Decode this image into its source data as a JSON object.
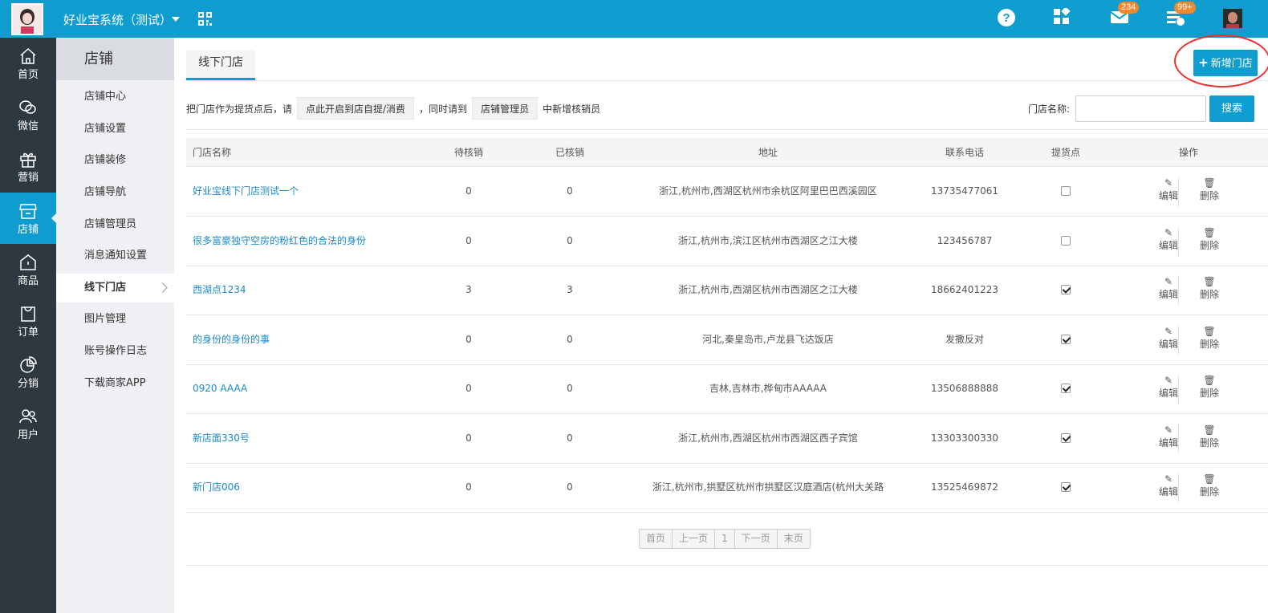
{
  "header": {
    "app_title": "好业宝系统（测试）",
    "messages_badge": "234",
    "tasks_badge": "99+",
    "icons": [
      "qrcode-icon",
      "help-icon",
      "apps-icon",
      "mail-icon",
      "tasks-icon"
    ]
  },
  "leftnav": {
    "items": [
      {
        "label": "首页",
        "icon": "home-icon"
      },
      {
        "label": "微信",
        "icon": "wechat-icon"
      },
      {
        "label": "营销",
        "icon": "gift-icon"
      },
      {
        "label": "店铺",
        "icon": "store-icon",
        "active": true
      },
      {
        "label": "商品",
        "icon": "bag-icon"
      },
      {
        "label": "订单",
        "icon": "order-icon"
      },
      {
        "label": "分销",
        "icon": "pie-icon"
      },
      {
        "label": "用户",
        "icon": "users-icon"
      }
    ]
  },
  "subnav": {
    "title": "店铺",
    "items": [
      {
        "label": "店铺中心"
      },
      {
        "label": "店铺设置"
      },
      {
        "label": "店铺装修"
      },
      {
        "label": "店铺导航"
      },
      {
        "label": "店铺管理员"
      },
      {
        "label": "消息通知设置"
      },
      {
        "label": "线下门店",
        "active": true
      },
      {
        "label": "图片管理"
      },
      {
        "label": "账号操作日志"
      },
      {
        "label": "下载商家APP"
      }
    ]
  },
  "main": {
    "tab": "线下门店",
    "add_button": "新增门店",
    "info": {
      "prefix": "把门店作为提货点后，请",
      "btn1": "点此开启到店自提/消费",
      "middle": "，同时请到",
      "btn2": "店铺管理员",
      "suffix": "中新增核销员"
    },
    "search": {
      "label": "门店名称:",
      "value": "",
      "button": "搜索"
    }
  },
  "table": {
    "columns": [
      "门店名称",
      "待核销",
      "已核销",
      "地址",
      "联系电话",
      "提货点",
      "操作"
    ],
    "edit_label": "编辑",
    "delete_label": "删除",
    "rows": [
      {
        "name": "好业宝线下门店测试一个",
        "pending": "0",
        "verified": "0",
        "address": "浙江,杭州市,西湖区杭州市余杭区阿里巴巴西溪园区",
        "phone": "13735477061",
        "pickup": false
      },
      {
        "name": "很多富豪独守空房的粉红色的合法的身份",
        "pending": "0",
        "verified": "0",
        "address": "浙江,杭州市,滨江区杭州市西湖区之江大楼",
        "phone": "123456787",
        "pickup": false
      },
      {
        "name": "西湖点1234",
        "pending": "3",
        "verified": "3",
        "address": "浙江,杭州市,西湖区杭州市西湖区之江大楼",
        "phone": "18662401223",
        "pickup": true
      },
      {
        "name": "的身份的身份的事",
        "pending": "0",
        "verified": "0",
        "address": "河北,秦皇岛市,卢龙县飞达饭店",
        "phone": "发撒反对",
        "pickup": true
      },
      {
        "name": "0920 AAAA",
        "pending": "0",
        "verified": "0",
        "address": "吉林,吉林市,桦甸市AAAAA",
        "phone": "13506888888",
        "pickup": true
      },
      {
        "name": "新店面330号",
        "pending": "0",
        "verified": "0",
        "address": "浙江,杭州市,西湖区杭州市西湖区西子宾馆",
        "phone": "13303300330",
        "pickup": true
      },
      {
        "name": "新门店006",
        "pending": "0",
        "verified": "0",
        "address": "浙江,杭州市,拱墅区杭州市拱墅区汉庭酒店(杭州大关路店)",
        "phone": "13525469872",
        "pickup": true
      }
    ]
  },
  "pagination": {
    "first": "首页",
    "prev": "上一页",
    "current": "1",
    "next": "下一页",
    "last": "末页"
  }
}
